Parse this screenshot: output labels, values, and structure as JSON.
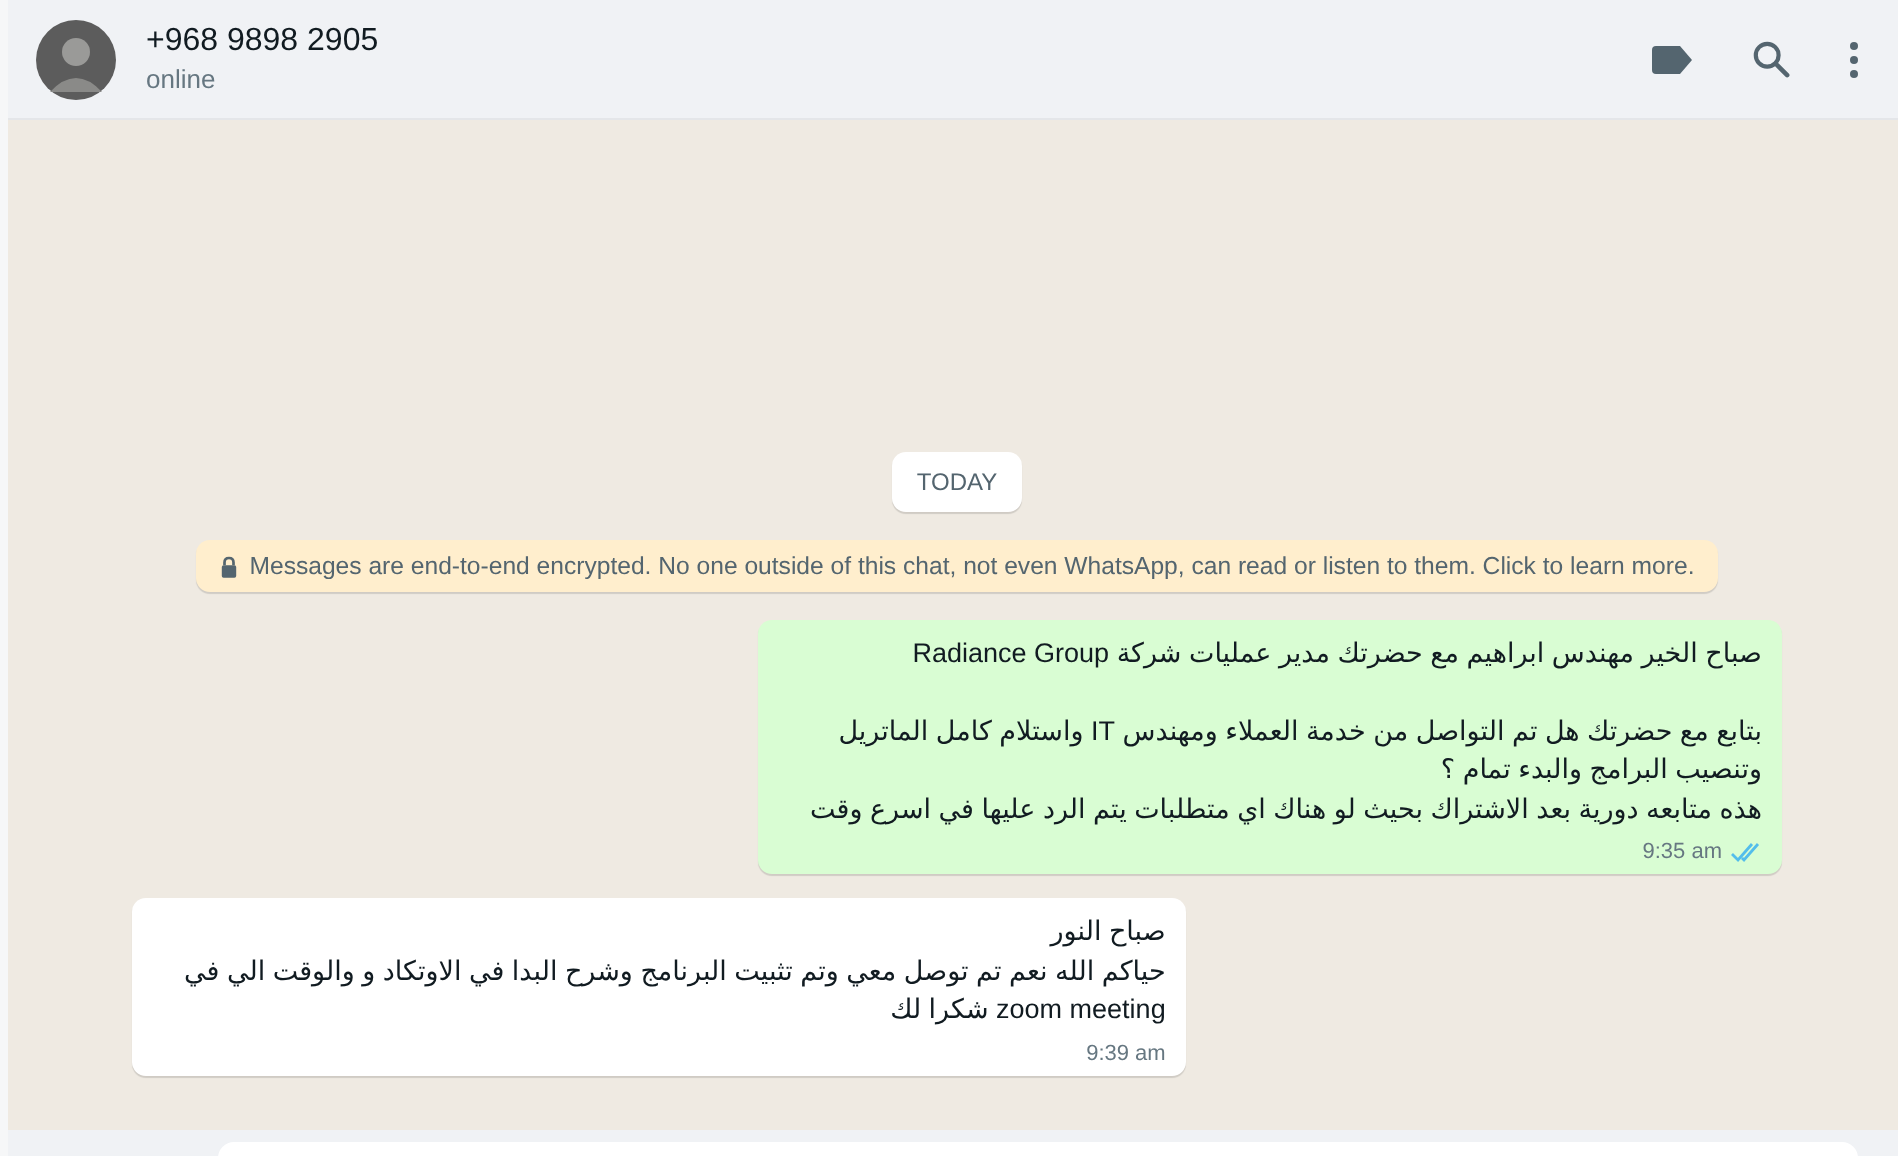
{
  "header": {
    "contact": "+968 9898 2905",
    "status": "online"
  },
  "date_chip": "TODAY",
  "encryption_notice": "Messages are end-to-end encrypted. No one outside of this chat, not even WhatsApp, can read or listen to them. Click to learn more.",
  "messages": [
    {
      "kind": "outgoing",
      "paragraphs": [
        [
          "صباح الخير مهندس ابراهيم مع حضرتك مدير عمليات شركة Radiance Group"
        ],
        [
          "بتابع مع حضرتك هل تم التواصل من خدمة العملاء ومهندس IT واستلام كامل الماتريل",
          "وتنصيب البرامج والبدء تمام ؟",
          "هذه متابعه دورية بعد الاشتراك بحيث لو هناك اي متطلبات يتم الرد عليها في اسرع وقت"
        ]
      ],
      "time": "9:35 am",
      "read": true
    },
    {
      "kind": "incoming",
      "paragraphs": [
        [
          "صباح النور",
          "حياكم الله نعم تم توصل معي وتم تثبيت البرنامج وشرح البدا في الاوتكاد و والوقت الي في",
          "zoom meeting شكرا لك"
        ]
      ],
      "time": "9:39 am"
    }
  ]
}
